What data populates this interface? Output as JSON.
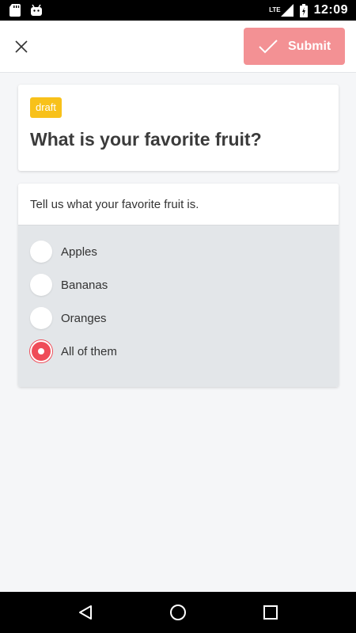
{
  "status_bar": {
    "time": "12:09",
    "network": "LTE",
    "icons": [
      "sd-card-icon",
      "android-icon",
      "signal-icon",
      "battery-icon"
    ]
  },
  "app_bar": {
    "close_icon": "close-icon",
    "submit_label": "Submit",
    "submit_icon": "check-icon",
    "submit_color": "#f39194"
  },
  "question": {
    "status_badge": "draft",
    "badge_color": "#f8c11a",
    "title": "What is your favorite fruit?",
    "description": "Tell us what your favorite fruit is.",
    "options": [
      {
        "label": "Apples",
        "selected": false
      },
      {
        "label": "Bananas",
        "selected": false
      },
      {
        "label": "Oranges",
        "selected": false
      },
      {
        "label": "All of them",
        "selected": true
      }
    ],
    "selected_color": "#ef4c58"
  },
  "nav_bar": {
    "buttons": [
      "back-icon",
      "home-icon",
      "recents-icon"
    ]
  }
}
